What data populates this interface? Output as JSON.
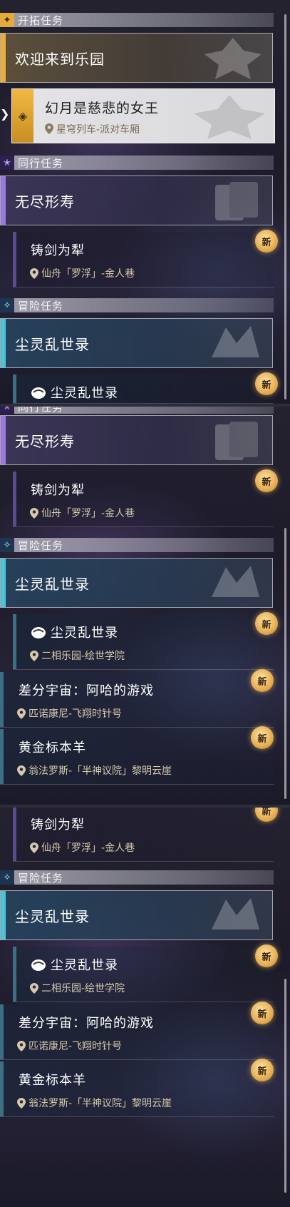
{
  "sections": {
    "trailblaze": "开拓任务",
    "companion": "同行任务",
    "adventure": "冒险任务"
  },
  "missions": {
    "welcome": "欢迎来到乐园",
    "selected": {
      "title": "幻月是慈悲的女王",
      "location": "星穹列车-派对车厢"
    },
    "endless": "无尽形寿",
    "sword": {
      "title": "铸剑为犁",
      "location": "仙舟「罗浮」-金人巷"
    },
    "dust": "尘灵乱世录",
    "dust_item": {
      "title": "尘灵乱世录",
      "location": "二相乐园-绘世学院"
    },
    "diff": {
      "title": "差分宇宙：阿哈的游戏",
      "location": "匹诺康尼-飞翔时针号"
    },
    "golden": {
      "title": "黄金标本羊",
      "location": "翁法罗斯-「半神议院」黎明云崖"
    }
  },
  "badge_label": "新",
  "icons": {
    "trailblaze": "star-gold-icon",
    "companion": "star-purple-icon",
    "adventure": "compass-icon",
    "pin": "location-pin-icon",
    "new": "new-badge-icon"
  },
  "colors": {
    "gold_accent": "#e8ad3b",
    "purple_accent": "#9a79dd",
    "teal_accent": "#4fc2d6",
    "location_text": "#d8c9ad"
  }
}
